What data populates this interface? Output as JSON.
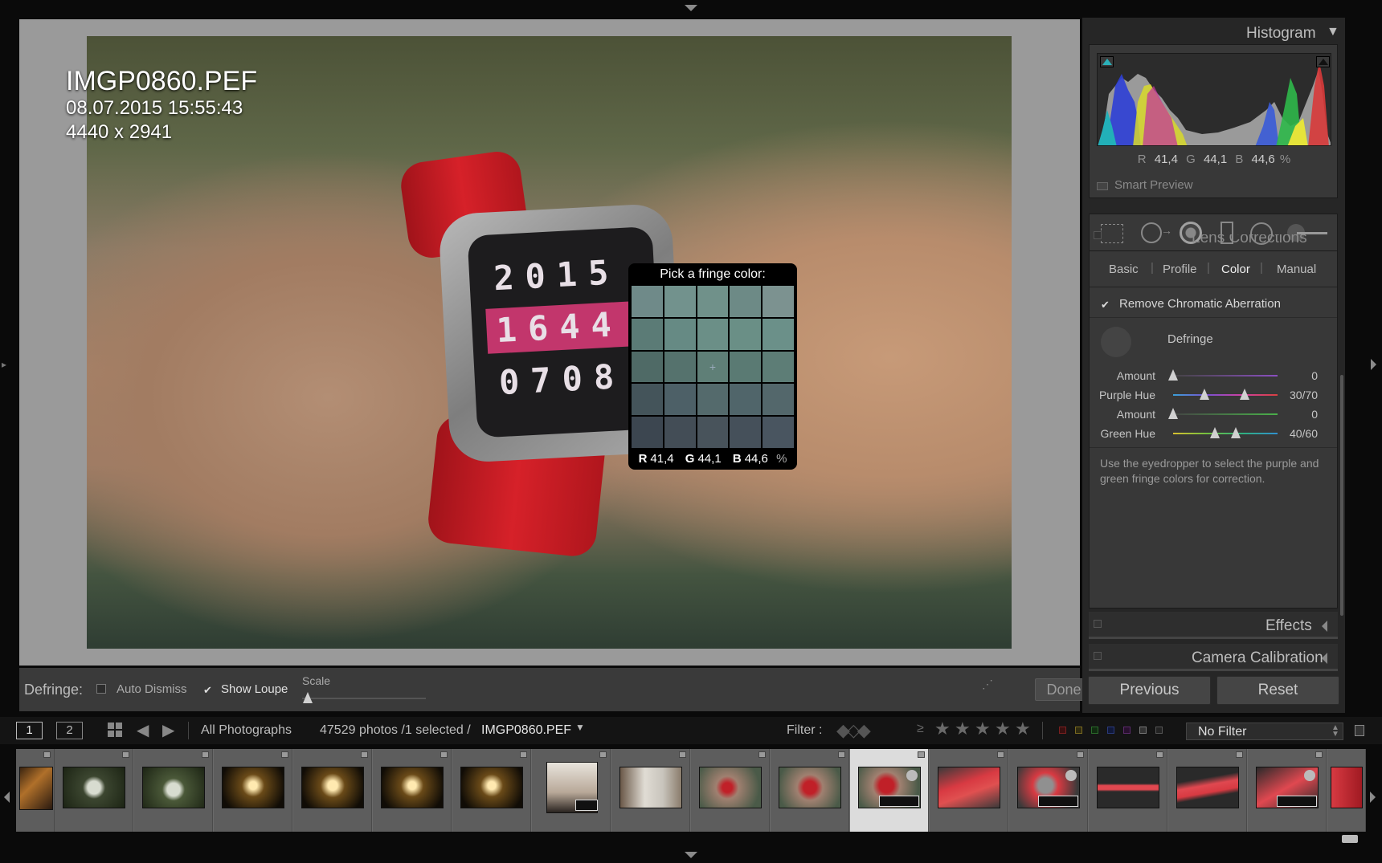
{
  "photo": {
    "filename": "IMGP0860.PEF",
    "datetime": "08.07.2015 15:55:43",
    "dimensions": "4440 x 2941",
    "watch_rows": [
      "2015",
      "1644",
      "0708"
    ]
  },
  "loupe": {
    "title": "Pick a fringe color:",
    "r_label": "R",
    "r_value": "41,4",
    "g_label": "G",
    "g_value": "44,1",
    "b_label": "B",
    "b_value": "44,6",
    "unit": "%",
    "swatches": [
      "#6f8a89",
      "#72928d",
      "#70918a",
      "#6d8a86",
      "#7c9290",
      "#5b7b76",
      "#668a84",
      "#6b8f87",
      "#6a8f86",
      "#6b9089",
      "#4f6a66",
      "#55726d",
      "#5f7f77",
      "#5a7a73",
      "#5d7d76",
      "#44545a",
      "#4d6067",
      "#546a6c",
      "#50656a",
      "#53676b",
      "#3c4650",
      "#434d56",
      "#48535b",
      "#45505a",
      "#495560"
    ]
  },
  "toolbar": {
    "label": "Defringe:",
    "auto_dismiss": "Auto Dismiss",
    "show_loupe": "Show Loupe",
    "scale": "Scale",
    "done": "Done"
  },
  "histogram": {
    "title": "Histogram",
    "r_label": "R",
    "r_value": "41,4",
    "g_label": "G",
    "g_value": "44,1",
    "b_label": "B",
    "b_value": "44,6",
    "unit": "%",
    "smart_preview": "Smart Preview"
  },
  "lens": {
    "section_title": "Lens Corrections",
    "tabs": [
      "Basic",
      "Profile",
      "Color",
      "Manual"
    ],
    "active_tab": "Color",
    "remove_ca": "Remove Chromatic Aberration",
    "defringe": "Defringe",
    "sliders": [
      {
        "label": "Amount",
        "value": "0"
      },
      {
        "label": "Purple Hue",
        "value": "30/70"
      },
      {
        "label": "Amount",
        "value": "0"
      },
      {
        "label": "Green Hue",
        "value": "40/60"
      }
    ],
    "help": "Use the eyedropper to select the purple and green fringe colors for correction."
  },
  "panels": {
    "effects": "Effects",
    "camera_calibration": "Camera Calibration"
  },
  "buttons": {
    "previous": "Previous",
    "reset": "Reset"
  },
  "filterbar": {
    "view1": "1",
    "view2": "2",
    "source": "All Photographs",
    "count": "47529 photos /1 selected /",
    "selected_file": "IMGP0860.PEF",
    "filter_label": "Filter :",
    "gte": "≥",
    "filter_value": "No Filter"
  },
  "colors": {
    "accent_teal": "#2bb0b8",
    "panel_bg": "#383838",
    "selected_cell": "#dcdcdc"
  }
}
